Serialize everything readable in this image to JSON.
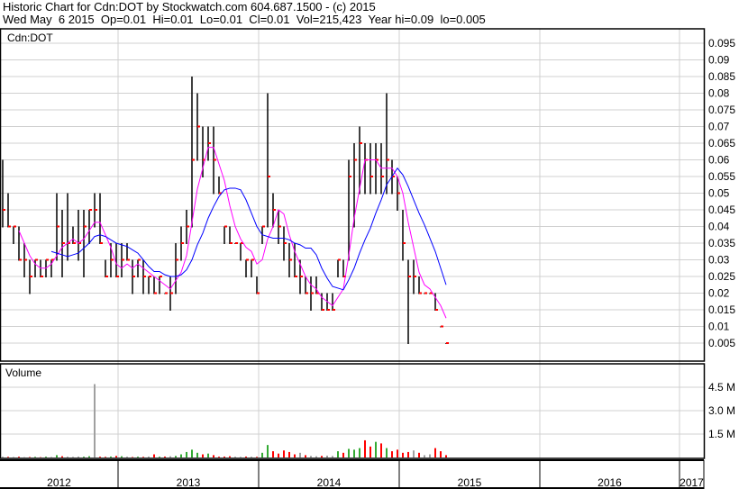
{
  "header": {
    "line1": "Historic Chart for Cdn:DOT by Stockwatch.com 604.687.1500 - (c) 2015",
    "line2": "Wed May  6 2015  Op=0.01  Hi=0.01  Lo=0.01  Cl=0.01  Vol=215,423  Year hi=0.09  lo=0.005"
  },
  "chart_data": {
    "type": "bar",
    "title": "Cdn:DOT",
    "volume_label": "Volume",
    "x_tick_labels": [
      "2012",
      "2013",
      "2014",
      "2015",
      "2016",
      "2017"
    ],
    "y_tick_labels": [
      "0.095",
      "0.09",
      "0.085",
      "0.08",
      "0.075",
      "0.07",
      "0.065",
      "0.06",
      "0.055",
      "0.05",
      "0.045",
      "0.04",
      "0.035",
      "0.03",
      "0.025",
      "0.02",
      "0.015",
      "0.01",
      "0.005"
    ],
    "ylim": [
      0,
      0.1
    ],
    "volume_tick_labels": [
      "4.5 M",
      "3.0 M",
      "1.5 M"
    ],
    "volume_ticks": [
      4.5,
      3.0,
      1.5
    ],
    "moving_averages": [
      {
        "name": "short",
        "window": 4,
        "color": "#ff00ff"
      },
      {
        "name": "long",
        "window": 10,
        "color": "#0000ff"
      }
    ],
    "colors": {
      "bar": "#000000",
      "close": "#ff0000",
      "up": "#33aa33",
      "down": "#ff0000",
      "flat": "#a0a0a0"
    },
    "ohlc": [
      [
        0.06,
        0.04,
        0.045
      ],
      [
        0.05,
        0.04,
        0.04
      ],
      [
        0.04,
        0.035,
        0.04
      ],
      [
        0.04,
        0.03,
        0.03
      ],
      [
        0.035,
        0.025,
        0.03
      ],
      [
        0.03,
        0.02,
        0.025
      ],
      [
        0.03,
        0.025,
        0.03
      ],
      [
        0.03,
        0.025,
        0.025
      ],
      [
        0.03,
        0.025,
        0.03
      ],
      [
        0.03,
        0.025,
        0.03
      ],
      [
        0.05,
        0.03,
        0.04
      ],
      [
        0.045,
        0.025,
        0.035
      ],
      [
        0.05,
        0.03,
        0.035
      ],
      [
        0.04,
        0.035,
        0.035
      ],
      [
        0.045,
        0.03,
        0.035
      ],
      [
        0.045,
        0.025,
        0.04
      ],
      [
        0.045,
        0.035,
        0.045
      ],
      [
        0.05,
        0.04,
        0.045
      ],
      [
        0.05,
        0.035,
        0.035
      ],
      [
        0.03,
        0.025,
        0.025
      ],
      [
        0.035,
        0.025,
        0.03
      ],
      [
        0.035,
        0.025,
        0.025
      ],
      [
        0.035,
        0.025,
        0.03
      ],
      [
        0.035,
        0.03,
        0.03
      ],
      [
        0.03,
        0.02,
        0.025
      ],
      [
        0.03,
        0.025,
        0.03
      ],
      [
        0.03,
        0.02,
        0.025
      ],
      [
        0.025,
        0.02,
        0.025
      ],
      [
        0.025,
        0.02,
        0.02
      ],
      [
        0.025,
        0.02,
        0.025
      ],
      [
        0.02,
        0.02,
        0.02
      ],
      [
        0.025,
        0.015,
        0.02
      ],
      [
        0.035,
        0.02,
        0.03
      ],
      [
        0.04,
        0.03,
        0.035
      ],
      [
        0.045,
        0.035,
        0.04
      ],
      [
        0.085,
        0.04,
        0.06
      ],
      [
        0.08,
        0.06,
        0.07
      ],
      [
        0.07,
        0.055,
        0.06
      ],
      [
        0.07,
        0.06,
        0.065
      ],
      [
        0.07,
        0.05,
        0.06
      ],
      [
        0.055,
        0.05,
        0.05
      ],
      [
        0.04,
        0.035,
        0.04
      ],
      [
        0.04,
        0.035,
        0.035
      ],
      [
        0.035,
        0.035,
        0.035
      ],
      [
        0.035,
        0.03,
        0.035
      ],
      [
        0.03,
        0.025,
        0.03
      ],
      [
        0.03,
        0.025,
        0.03
      ],
      [
        0.025,
        0.02,
        0.02
      ],
      [
        0.04,
        0.035,
        0.04
      ],
      [
        0.08,
        0.04,
        0.055
      ],
      [
        0.05,
        0.04,
        0.045
      ],
      [
        0.045,
        0.035,
        0.04
      ],
      [
        0.04,
        0.03,
        0.035
      ],
      [
        0.035,
        0.025,
        0.03
      ],
      [
        0.035,
        0.025,
        0.025
      ],
      [
        0.03,
        0.02,
        0.025
      ],
      [
        0.025,
        0.02,
        0.02
      ],
      [
        0.025,
        0.015,
        0.02
      ],
      [
        0.025,
        0.02,
        0.02
      ],
      [
        0.02,
        0.015,
        0.015
      ],
      [
        0.02,
        0.015,
        0.015
      ],
      [
        0.02,
        0.015,
        0.015
      ],
      [
        0.03,
        0.025,
        0.03
      ],
      [
        0.03,
        0.025,
        0.025
      ],
      [
        0.06,
        0.03,
        0.055
      ],
      [
        0.065,
        0.04,
        0.06
      ],
      [
        0.07,
        0.05,
        0.065
      ],
      [
        0.065,
        0.05,
        0.06
      ],
      [
        0.065,
        0.05,
        0.055
      ],
      [
        0.065,
        0.05,
        0.06
      ],
      [
        0.065,
        0.05,
        0.055
      ],
      [
        0.08,
        0.05,
        0.06
      ],
      [
        0.06,
        0.05,
        0.055
      ],
      [
        0.055,
        0.045,
        0.05
      ],
      [
        0.045,
        0.03,
        0.035
      ],
      [
        0.03,
        0.005,
        0.025
      ],
      [
        0.03,
        0.02,
        0.025
      ],
      [
        0.025,
        0.02,
        0.02
      ],
      [
        0.02,
        0.02,
        0.02
      ],
      [
        0.02,
        0.02,
        0.02
      ],
      [
        0.02,
        0.015,
        0.015
      ],
      [
        0.01,
        0.01,
        0.01
      ],
      [
        0.005,
        0.005,
        0.005
      ]
    ],
    "volume_millions": [
      0.05,
      0.04,
      0.03,
      0.05,
      0.02,
      0.03,
      0.04,
      0.02,
      0.05,
      0.03,
      0.15,
      0.08,
      0.05,
      0.04,
      0.06,
      0.05,
      0.08,
      4.7,
      0.05,
      0.04,
      0.06,
      0.1,
      0.08,
      0.05,
      0.03,
      0.05,
      0.04,
      0.06,
      0.2,
      0.05,
      0.06,
      0.08,
      0.1,
      0.2,
      0.35,
      0.5,
      0.3,
      0.2,
      0.25,
      0.15,
      0.05,
      0.06,
      0.08,
      0.05,
      0.04,
      0.06,
      0.05,
      0.04,
      0.3,
      0.8,
      0.4,
      0.25,
      0.45,
      0.35,
      0.2,
      0.3,
      0.15,
      0.1,
      0.08,
      0.1,
      0.12,
      0.1,
      0.4,
      0.3,
      0.55,
      0.5,
      0.6,
      1.1,
      0.7,
      1.0,
      0.9,
      0.6,
      0.4,
      0.5,
      0.3,
      0.35,
      0.45,
      0.3,
      0.15,
      0.2,
      0.6,
      0.4,
      0.15
    ]
  }
}
